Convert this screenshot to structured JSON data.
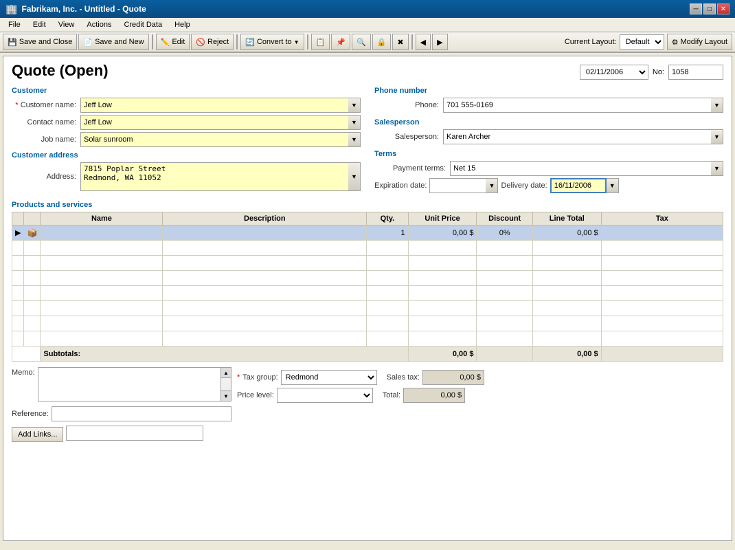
{
  "titlebar": {
    "icon": "🏢",
    "title": "Fabrikam, Inc. - Untitled - Quote",
    "min": "─",
    "max": "□",
    "close": "✕"
  },
  "menubar": {
    "items": [
      "File",
      "Edit",
      "View",
      "Actions",
      "Credit Data",
      "Help"
    ]
  },
  "toolbar": {
    "save_close": "Save and Close",
    "save_new": "Save and New",
    "edit": "Edit",
    "reject": "Reject",
    "convert_to": "Convert to",
    "layout_label": "Current Layout:",
    "layout_value": "Default",
    "modify_layout": "Modify Layout"
  },
  "quote": {
    "title": "Quote (Open)",
    "date": "02/11/2006",
    "no_label": "No:",
    "no_value": "1058"
  },
  "customer": {
    "section_title": "Customer",
    "customer_name_label": "Customer name:",
    "customer_name_value": "Jeff Low",
    "contact_name_label": "Contact name:",
    "contact_name_value": "Jeff Low",
    "job_name_label": "Job name:",
    "job_name_value": "Solar sunroom",
    "address_section": "Customer address",
    "address_label": "Address:",
    "address_value": "7815 Poplar Street\nRedmond, WA 11052"
  },
  "right_panel": {
    "phone_section": "Phone number",
    "phone_label": "Phone:",
    "phone_value": "701 555-0169",
    "salesperson_section": "Salesperson",
    "salesperson_label": "Salesperson:",
    "salesperson_value": "Karen Archer",
    "terms_section": "Terms",
    "payment_terms_label": "Payment terms:",
    "payment_terms_value": "Net 15",
    "expiration_label": "Expiration date:",
    "expiration_value": "",
    "delivery_label": "Delivery date:",
    "delivery_value": "16/11/2006"
  },
  "products": {
    "section_title": "Products and services",
    "columns": [
      "Name",
      "Description",
      "Qty.",
      "Unit Price",
      "Discount",
      "Line Total",
      "Tax"
    ],
    "rows": [
      {
        "selected": true,
        "has_arrow": true,
        "name": "",
        "description": "",
        "qty": "1",
        "unit_price": "0,00 $",
        "discount": "0%",
        "line_total": "0,00 $",
        "tax": ""
      }
    ],
    "empty_rows": 7,
    "subtotals_label": "Subtotals:",
    "subtotals_discount": "0,00 $",
    "subtotals_total": "0,00 $"
  },
  "bottom": {
    "memo_label": "Memo:",
    "memo_value": "",
    "reference_label": "Reference:",
    "reference_value": "",
    "add_links": "Add Links...",
    "links_value": "",
    "tax_group_label": "Tax group:",
    "tax_group_value": "Redmond",
    "price_level_label": "Price level:",
    "price_level_value": "",
    "sales_tax_label": "Sales tax:",
    "sales_tax_value": "0,00 $",
    "total_label": "Total:",
    "total_value": "0,00 $"
  }
}
